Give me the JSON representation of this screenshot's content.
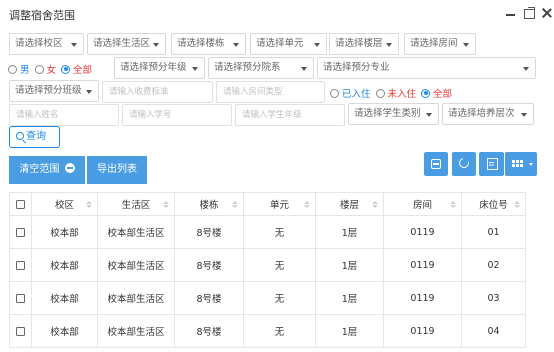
{
  "window": {
    "title": "调整宿舍范围",
    "controls": [
      "minimize-icon",
      "maximize-icon",
      "close-icon"
    ]
  },
  "filters": {
    "row1_selects": [
      "请选择校区",
      "请选择生活区",
      "请选择楼栋",
      "请选择单元",
      "请选择楼层",
      "请选择房间"
    ],
    "gender": {
      "options": [
        "男",
        "女",
        "全部"
      ],
      "selected": "全部"
    },
    "row2_selects": [
      "请选择预分年级",
      "请选择预分院系",
      "请选择预分专业"
    ],
    "class_select": "请选择预分班级",
    "standard_placeholder": "请输入收费标准",
    "room_type_placeholder": "请输入房间类型",
    "occupancy": {
      "options": [
        "已入住",
        "未入住",
        "全部"
      ],
      "selected": "全部"
    },
    "name_placeholder": "请输入姓名",
    "student_no_placeholder": "请输入学号",
    "year_placeholder": "请输入学生年级",
    "student_type_select": "请选择学生类别",
    "training_level_select": "请选择培养层次"
  },
  "query_button": "查询",
  "toolbar": {
    "clear_label": "清空范围",
    "export_label": "导出列表",
    "icons": [
      "collapse-icon",
      "refresh-icon",
      "list-icon",
      "columns-icon"
    ]
  },
  "table": {
    "columns": [
      "校区",
      "生活区",
      "楼栋",
      "单元",
      "楼层",
      "房间",
      "床位号"
    ],
    "rows": [
      [
        "校本部",
        "校本部生活区",
        "8号楼",
        "无",
        "1层",
        "0119",
        "01"
      ],
      [
        "校本部",
        "校本部生活区",
        "8号楼",
        "无",
        "1层",
        "0119",
        "02"
      ],
      [
        "校本部",
        "校本部生活区",
        "8号楼",
        "无",
        "1层",
        "0119",
        "03"
      ],
      [
        "校本部",
        "校本部生活区",
        "8号楼",
        "无",
        "1层",
        "0119",
        "04"
      ]
    ]
  },
  "colors": {
    "accent": "#4a9de2",
    "link_blue": "#1e88e5",
    "gender_female": "#e53935",
    "occupancy_unoccupied": "#e53935",
    "occupancy_all": "#e53935"
  }
}
